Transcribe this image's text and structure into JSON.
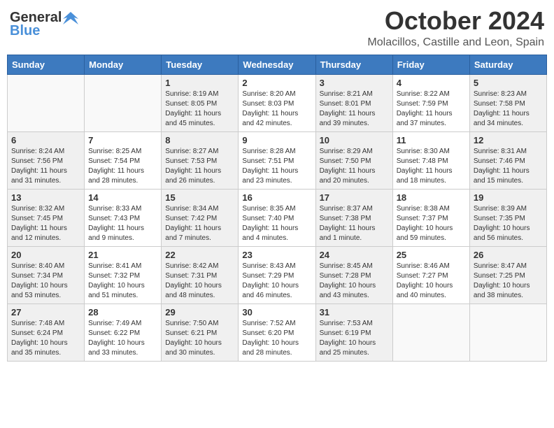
{
  "header": {
    "logo_general": "General",
    "logo_blue": "Blue",
    "month_year": "October 2024",
    "location": "Molacillos, Castille and Leon, Spain"
  },
  "days_of_week": [
    "Sunday",
    "Monday",
    "Tuesday",
    "Wednesday",
    "Thursday",
    "Friday",
    "Saturday"
  ],
  "weeks": [
    [
      {
        "day": "",
        "sunrise": "",
        "sunset": "",
        "daylight": ""
      },
      {
        "day": "",
        "sunrise": "",
        "sunset": "",
        "daylight": ""
      },
      {
        "day": "1",
        "sunrise": "Sunrise: 8:19 AM",
        "sunset": "Sunset: 8:05 PM",
        "daylight": "Daylight: 11 hours and 45 minutes."
      },
      {
        "day": "2",
        "sunrise": "Sunrise: 8:20 AM",
        "sunset": "Sunset: 8:03 PM",
        "daylight": "Daylight: 11 hours and 42 minutes."
      },
      {
        "day": "3",
        "sunrise": "Sunrise: 8:21 AM",
        "sunset": "Sunset: 8:01 PM",
        "daylight": "Daylight: 11 hours and 39 minutes."
      },
      {
        "day": "4",
        "sunrise": "Sunrise: 8:22 AM",
        "sunset": "Sunset: 7:59 PM",
        "daylight": "Daylight: 11 hours and 37 minutes."
      },
      {
        "day": "5",
        "sunrise": "Sunrise: 8:23 AM",
        "sunset": "Sunset: 7:58 PM",
        "daylight": "Daylight: 11 hours and 34 minutes."
      }
    ],
    [
      {
        "day": "6",
        "sunrise": "Sunrise: 8:24 AM",
        "sunset": "Sunset: 7:56 PM",
        "daylight": "Daylight: 11 hours and 31 minutes."
      },
      {
        "day": "7",
        "sunrise": "Sunrise: 8:25 AM",
        "sunset": "Sunset: 7:54 PM",
        "daylight": "Daylight: 11 hours and 28 minutes."
      },
      {
        "day": "8",
        "sunrise": "Sunrise: 8:27 AM",
        "sunset": "Sunset: 7:53 PM",
        "daylight": "Daylight: 11 hours and 26 minutes."
      },
      {
        "day": "9",
        "sunrise": "Sunrise: 8:28 AM",
        "sunset": "Sunset: 7:51 PM",
        "daylight": "Daylight: 11 hours and 23 minutes."
      },
      {
        "day": "10",
        "sunrise": "Sunrise: 8:29 AM",
        "sunset": "Sunset: 7:50 PM",
        "daylight": "Daylight: 11 hours and 20 minutes."
      },
      {
        "day": "11",
        "sunrise": "Sunrise: 8:30 AM",
        "sunset": "Sunset: 7:48 PM",
        "daylight": "Daylight: 11 hours and 18 minutes."
      },
      {
        "day": "12",
        "sunrise": "Sunrise: 8:31 AM",
        "sunset": "Sunset: 7:46 PM",
        "daylight": "Daylight: 11 hours and 15 minutes."
      }
    ],
    [
      {
        "day": "13",
        "sunrise": "Sunrise: 8:32 AM",
        "sunset": "Sunset: 7:45 PM",
        "daylight": "Daylight: 11 hours and 12 minutes."
      },
      {
        "day": "14",
        "sunrise": "Sunrise: 8:33 AM",
        "sunset": "Sunset: 7:43 PM",
        "daylight": "Daylight: 11 hours and 9 minutes."
      },
      {
        "day": "15",
        "sunrise": "Sunrise: 8:34 AM",
        "sunset": "Sunset: 7:42 PM",
        "daylight": "Daylight: 11 hours and 7 minutes."
      },
      {
        "day": "16",
        "sunrise": "Sunrise: 8:35 AM",
        "sunset": "Sunset: 7:40 PM",
        "daylight": "Daylight: 11 hours and 4 minutes."
      },
      {
        "day": "17",
        "sunrise": "Sunrise: 8:37 AM",
        "sunset": "Sunset: 7:38 PM",
        "daylight": "Daylight: 11 hours and 1 minute."
      },
      {
        "day": "18",
        "sunrise": "Sunrise: 8:38 AM",
        "sunset": "Sunset: 7:37 PM",
        "daylight": "Daylight: 10 hours and 59 minutes."
      },
      {
        "day": "19",
        "sunrise": "Sunrise: 8:39 AM",
        "sunset": "Sunset: 7:35 PM",
        "daylight": "Daylight: 10 hours and 56 minutes."
      }
    ],
    [
      {
        "day": "20",
        "sunrise": "Sunrise: 8:40 AM",
        "sunset": "Sunset: 7:34 PM",
        "daylight": "Daylight: 10 hours and 53 minutes."
      },
      {
        "day": "21",
        "sunrise": "Sunrise: 8:41 AM",
        "sunset": "Sunset: 7:32 PM",
        "daylight": "Daylight: 10 hours and 51 minutes."
      },
      {
        "day": "22",
        "sunrise": "Sunrise: 8:42 AM",
        "sunset": "Sunset: 7:31 PM",
        "daylight": "Daylight: 10 hours and 48 minutes."
      },
      {
        "day": "23",
        "sunrise": "Sunrise: 8:43 AM",
        "sunset": "Sunset: 7:29 PM",
        "daylight": "Daylight: 10 hours and 46 minutes."
      },
      {
        "day": "24",
        "sunrise": "Sunrise: 8:45 AM",
        "sunset": "Sunset: 7:28 PM",
        "daylight": "Daylight: 10 hours and 43 minutes."
      },
      {
        "day": "25",
        "sunrise": "Sunrise: 8:46 AM",
        "sunset": "Sunset: 7:27 PM",
        "daylight": "Daylight: 10 hours and 40 minutes."
      },
      {
        "day": "26",
        "sunrise": "Sunrise: 8:47 AM",
        "sunset": "Sunset: 7:25 PM",
        "daylight": "Daylight: 10 hours and 38 minutes."
      }
    ],
    [
      {
        "day": "27",
        "sunrise": "Sunrise: 7:48 AM",
        "sunset": "Sunset: 6:24 PM",
        "daylight": "Daylight: 10 hours and 35 minutes."
      },
      {
        "day": "28",
        "sunrise": "Sunrise: 7:49 AM",
        "sunset": "Sunset: 6:22 PM",
        "daylight": "Daylight: 10 hours and 33 minutes."
      },
      {
        "day": "29",
        "sunrise": "Sunrise: 7:50 AM",
        "sunset": "Sunset: 6:21 PM",
        "daylight": "Daylight: 10 hours and 30 minutes."
      },
      {
        "day": "30",
        "sunrise": "Sunrise: 7:52 AM",
        "sunset": "Sunset: 6:20 PM",
        "daylight": "Daylight: 10 hours and 28 minutes."
      },
      {
        "day": "31",
        "sunrise": "Sunrise: 7:53 AM",
        "sunset": "Sunset: 6:19 PM",
        "daylight": "Daylight: 10 hours and 25 minutes."
      },
      {
        "day": "",
        "sunrise": "",
        "sunset": "",
        "daylight": ""
      },
      {
        "day": "",
        "sunrise": "",
        "sunset": "",
        "daylight": ""
      }
    ]
  ]
}
